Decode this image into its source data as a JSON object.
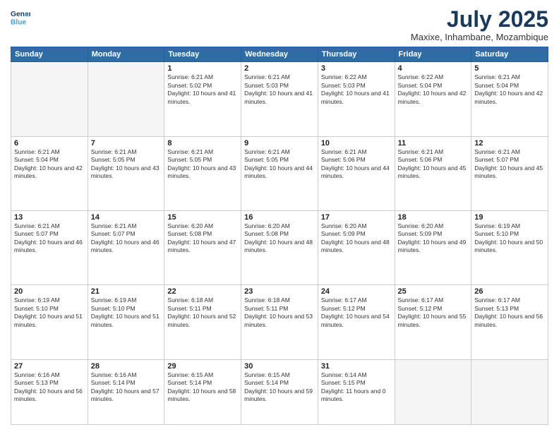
{
  "logo": {
    "line1": "General",
    "line2": "Blue"
  },
  "title": "July 2025",
  "subtitle": "Maxixe, Inhambane, Mozambique",
  "weekdays": [
    "Sunday",
    "Monday",
    "Tuesday",
    "Wednesday",
    "Thursday",
    "Friday",
    "Saturday"
  ],
  "weeks": [
    [
      {
        "day": "",
        "empty": true
      },
      {
        "day": "",
        "empty": true
      },
      {
        "day": "1",
        "sunrise": "6:21 AM",
        "sunset": "5:02 PM",
        "daylight": "10 hours and 41 minutes."
      },
      {
        "day": "2",
        "sunrise": "6:21 AM",
        "sunset": "5:03 PM",
        "daylight": "10 hours and 41 minutes."
      },
      {
        "day": "3",
        "sunrise": "6:22 AM",
        "sunset": "5:03 PM",
        "daylight": "10 hours and 41 minutes."
      },
      {
        "day": "4",
        "sunrise": "6:22 AM",
        "sunset": "5:04 PM",
        "daylight": "10 hours and 42 minutes."
      },
      {
        "day": "5",
        "sunrise": "6:21 AM",
        "sunset": "5:04 PM",
        "daylight": "10 hours and 42 minutes."
      }
    ],
    [
      {
        "day": "6",
        "sunrise": "6:21 AM",
        "sunset": "5:04 PM",
        "daylight": "10 hours and 42 minutes."
      },
      {
        "day": "7",
        "sunrise": "6:21 AM",
        "sunset": "5:05 PM",
        "daylight": "10 hours and 43 minutes."
      },
      {
        "day": "8",
        "sunrise": "6:21 AM",
        "sunset": "5:05 PM",
        "daylight": "10 hours and 43 minutes."
      },
      {
        "day": "9",
        "sunrise": "6:21 AM",
        "sunset": "5:05 PM",
        "daylight": "10 hours and 44 minutes."
      },
      {
        "day": "10",
        "sunrise": "6:21 AM",
        "sunset": "5:06 PM",
        "daylight": "10 hours and 44 minutes."
      },
      {
        "day": "11",
        "sunrise": "6:21 AM",
        "sunset": "5:06 PM",
        "daylight": "10 hours and 45 minutes."
      },
      {
        "day": "12",
        "sunrise": "6:21 AM",
        "sunset": "5:07 PM",
        "daylight": "10 hours and 45 minutes."
      }
    ],
    [
      {
        "day": "13",
        "sunrise": "6:21 AM",
        "sunset": "5:07 PM",
        "daylight": "10 hours and 46 minutes."
      },
      {
        "day": "14",
        "sunrise": "6:21 AM",
        "sunset": "5:07 PM",
        "daylight": "10 hours and 46 minutes."
      },
      {
        "day": "15",
        "sunrise": "6:20 AM",
        "sunset": "5:08 PM",
        "daylight": "10 hours and 47 minutes."
      },
      {
        "day": "16",
        "sunrise": "6:20 AM",
        "sunset": "5:08 PM",
        "daylight": "10 hours and 48 minutes."
      },
      {
        "day": "17",
        "sunrise": "6:20 AM",
        "sunset": "5:09 PM",
        "daylight": "10 hours and 48 minutes."
      },
      {
        "day": "18",
        "sunrise": "6:20 AM",
        "sunset": "5:09 PM",
        "daylight": "10 hours and 49 minutes."
      },
      {
        "day": "19",
        "sunrise": "6:19 AM",
        "sunset": "5:10 PM",
        "daylight": "10 hours and 50 minutes."
      }
    ],
    [
      {
        "day": "20",
        "sunrise": "6:19 AM",
        "sunset": "5:10 PM",
        "daylight": "10 hours and 51 minutes."
      },
      {
        "day": "21",
        "sunrise": "6:19 AM",
        "sunset": "5:10 PM",
        "daylight": "10 hours and 51 minutes."
      },
      {
        "day": "22",
        "sunrise": "6:18 AM",
        "sunset": "5:11 PM",
        "daylight": "10 hours and 52 minutes."
      },
      {
        "day": "23",
        "sunrise": "6:18 AM",
        "sunset": "5:11 PM",
        "daylight": "10 hours and 53 minutes."
      },
      {
        "day": "24",
        "sunrise": "6:17 AM",
        "sunset": "5:12 PM",
        "daylight": "10 hours and 54 minutes."
      },
      {
        "day": "25",
        "sunrise": "6:17 AM",
        "sunset": "5:12 PM",
        "daylight": "10 hours and 55 minutes."
      },
      {
        "day": "26",
        "sunrise": "6:17 AM",
        "sunset": "5:13 PM",
        "daylight": "10 hours and 56 minutes."
      }
    ],
    [
      {
        "day": "27",
        "sunrise": "6:16 AM",
        "sunset": "5:13 PM",
        "daylight": "10 hours and 56 minutes."
      },
      {
        "day": "28",
        "sunrise": "6:16 AM",
        "sunset": "5:14 PM",
        "daylight": "10 hours and 57 minutes."
      },
      {
        "day": "29",
        "sunrise": "6:15 AM",
        "sunset": "5:14 PM",
        "daylight": "10 hours and 58 minutes."
      },
      {
        "day": "30",
        "sunrise": "6:15 AM",
        "sunset": "5:14 PM",
        "daylight": "10 hours and 59 minutes."
      },
      {
        "day": "31",
        "sunrise": "6:14 AM",
        "sunset": "5:15 PM",
        "daylight": "11 hours and 0 minutes."
      },
      {
        "day": "",
        "empty": true
      },
      {
        "day": "",
        "empty": true
      }
    ]
  ]
}
